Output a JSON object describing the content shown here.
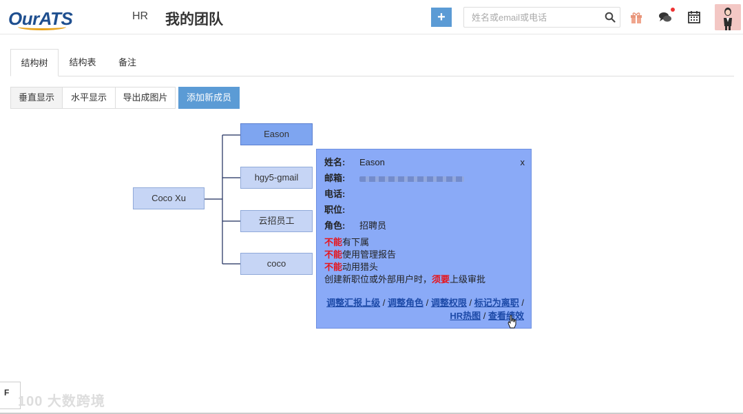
{
  "header": {
    "logo_text": "OurATS",
    "role": "HR",
    "title": "我的团队",
    "add_label": "+",
    "search_placeholder": "姓名或email或电话"
  },
  "tabs": [
    {
      "label": "结构树",
      "active": true
    },
    {
      "label": "结构表",
      "active": false
    },
    {
      "label": "备注",
      "active": false
    }
  ],
  "view_buttons": {
    "vertical": "垂直显示",
    "horizontal": "水平显示",
    "export": "导出成图片",
    "add_member": "添加新成员"
  },
  "tree": {
    "root": "Coco Xu",
    "children": [
      "Eason",
      "hgy5-gmail",
      "云招员工",
      "coco"
    ],
    "selected": "Eason"
  },
  "popup": {
    "close": "x",
    "name_label": "姓名:",
    "name_value": "Eason",
    "email_label": "邮箱:",
    "phone_label": "电话:",
    "position_label": "职位:",
    "role_label": "角色:",
    "role_value": "招聘员",
    "perms": [
      {
        "prefix": "不能",
        "text": "有下属"
      },
      {
        "prefix": "不能",
        "text": "使用管理报告"
      },
      {
        "prefix": "不能",
        "text": "动用猎头"
      }
    ],
    "approval_pre": "创建新职位或外部用户时，",
    "approval_red": "须要",
    "approval_post": "上级审批",
    "links": {
      "adjust_report": "调整汇报上级",
      "adjust_role": "调整角色",
      "adjust_perm": "调整权限",
      "mark_leave": "标记为离职",
      "hr_heat": "HR热图",
      "view_perf": "查看绩效"
    },
    "sep": "/"
  },
  "bottom": {
    "box_label": "F"
  },
  "colors": {
    "accent": "#5b9bd5",
    "node": "#c6d5f5",
    "node_selected": "#7ea5f0",
    "popup": "#8aaaf7",
    "warn": "#e8141a"
  }
}
